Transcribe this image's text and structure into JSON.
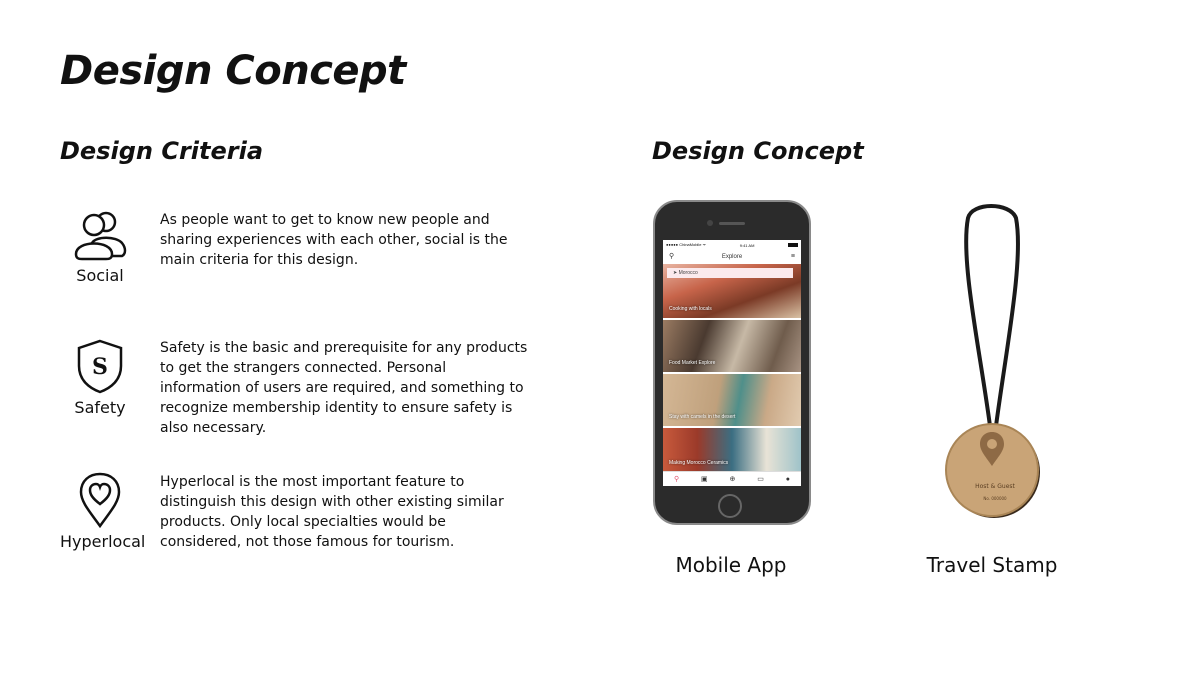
{
  "page": {
    "title": "Design Concept"
  },
  "criteria": {
    "heading": "Design Criteria",
    "items": [
      {
        "icon": "social-icon",
        "label": "Social",
        "description": "As people want to get to know new people and sharing experiences with each other, social is the main criteria for this design."
      },
      {
        "icon": "shield-icon",
        "label": "Safety",
        "description": "Safety is the basic and prerequisite for any products to get the strangers connected. Personal information of users are required, and something to recognize membership identity to ensure safety is also necessary."
      },
      {
        "icon": "location-heart-icon",
        "label": "Hyperlocal",
        "description": "Hyperlocal is the most important feature to distinguish this design with other existing similar products. Only local specialties would be considered, not those famous for tourism."
      }
    ]
  },
  "concept": {
    "heading": "Design Concept",
    "mobile_app": {
      "label": "Mobile App",
      "status_carrier": "●●●●● ChinaMobile ᯤ",
      "status_time": "9:41 AM",
      "screen_title": "Explore",
      "search_value": "Morocco",
      "cards": [
        "Cooking with locals",
        "Food Market Explore",
        "Stay with camels in the desert",
        "Making Morocco Ceramics"
      ]
    },
    "travel_stamp": {
      "label": "Travel Stamp",
      "engraving": "Host & Guest",
      "engraving_sub": "No. 000000"
    }
  }
}
